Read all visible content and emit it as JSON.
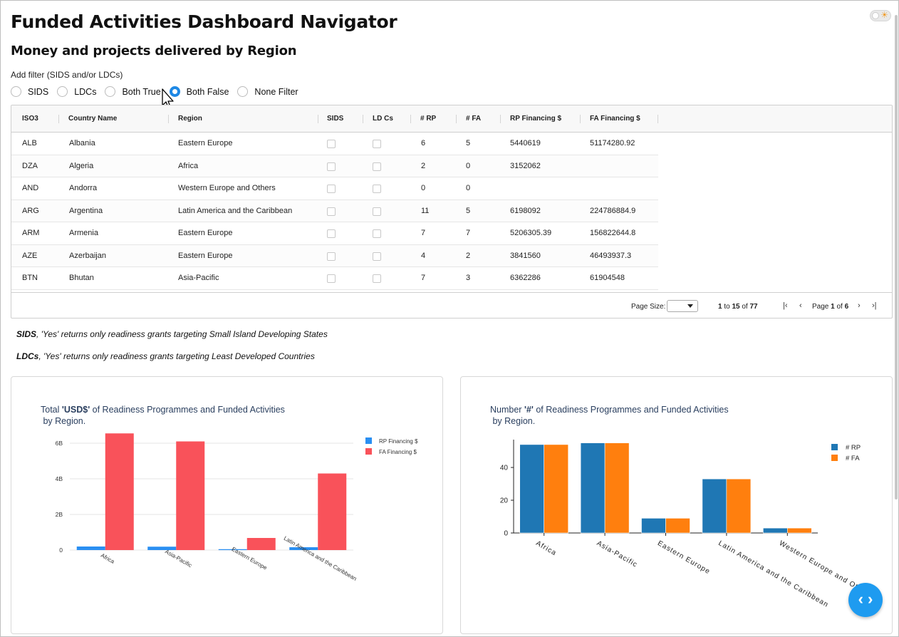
{
  "title": "Funded Activities Dashboard Navigator",
  "subtitle": "Money and projects delivered by Region",
  "filter": {
    "label": "Add filter (SIDS and/or LDCs)",
    "options": [
      "SIDS",
      "LDCs",
      "Both True",
      "Both False",
      "None Filter"
    ],
    "selected": "Both False"
  },
  "table": {
    "columns": [
      "ISO3",
      "Country Name",
      "Region",
      "SIDS",
      "LD Cs",
      "# RP",
      "# FA",
      "RP Financing $",
      "FA Financing $"
    ],
    "rows": [
      {
        "iso3": "ALB",
        "country": "Albania",
        "region": "Eastern Europe",
        "sids": false,
        "ldcs": false,
        "rp": "6",
        "fa": "5",
        "rp_fin": "5440619",
        "fa_fin": "51174280.92"
      },
      {
        "iso3": "DZA",
        "country": "Algeria",
        "region": "Africa",
        "sids": false,
        "ldcs": false,
        "rp": "2",
        "fa": "0",
        "rp_fin": "3152062",
        "fa_fin": ""
      },
      {
        "iso3": "AND",
        "country": "Andorra",
        "region": "Western Europe and Others",
        "sids": false,
        "ldcs": false,
        "rp": "0",
        "fa": "0",
        "rp_fin": "",
        "fa_fin": ""
      },
      {
        "iso3": "ARG",
        "country": "Argentina",
        "region": "Latin America and the Caribbean",
        "sids": false,
        "ldcs": false,
        "rp": "11",
        "fa": "5",
        "rp_fin": "6198092",
        "fa_fin": "224786884.9"
      },
      {
        "iso3": "ARM",
        "country": "Armenia",
        "region": "Eastern Europe",
        "sids": false,
        "ldcs": false,
        "rp": "7",
        "fa": "7",
        "rp_fin": "5206305.39",
        "fa_fin": "156822644.8"
      },
      {
        "iso3": "AZE",
        "country": "Azerbaijan",
        "region": "Eastern Europe",
        "sids": false,
        "ldcs": false,
        "rp": "4",
        "fa": "2",
        "rp_fin": "3841560",
        "fa_fin": "46493937.3"
      },
      {
        "iso3": "BTN",
        "country": "Bhutan",
        "region": "Asia-Pacific",
        "sids": false,
        "ldcs": false,
        "rp": "7",
        "fa": "3",
        "rp_fin": "6362286",
        "fa_fin": "61904548"
      }
    ],
    "pagination": {
      "page_size_label": "Page Size:",
      "range_from": "1",
      "range_to_word": "to",
      "range_to": "15",
      "range_of_word": "of",
      "range_total": "77",
      "page_word": "Page",
      "page_current": "1",
      "page_of_word": "of",
      "page_total": "6"
    }
  },
  "notes": {
    "sids_term": "SIDS",
    "sids_text": ", 'Yes' returns only readiness grants targeting Small Island Developing States",
    "ldcs_term": "LDCs",
    "ldcs_text": ", 'Yes' returns only readiness grants targeting Least Developed Countries"
  },
  "colors": {
    "accent": "#1e88e5",
    "rp_usd": "#2a8ff2",
    "fa_usd": "#f9525a",
    "rp_count": "#1f77b4",
    "fa_count": "#ff7f0e",
    "fab": "#1e9bf0"
  },
  "icons": {
    "toggle": "sun-icon",
    "fab": "code-icon",
    "pager": [
      "first-page-icon",
      "prev-page-icon",
      "next-page-icon",
      "last-page-icon"
    ]
  },
  "chart_data": [
    {
      "type": "bar",
      "title_prefix": "Total ",
      "title_bold": "'USD$'",
      "title_suffix": " of Readiness Programmes and Funded Activities",
      "title_line2": " by Region.",
      "categories": [
        "Africa",
        "Asia-Pacific",
        "Eastern Europe",
        "Latin America and the Caribbean"
      ],
      "series": [
        {
          "name": "RP Financing $",
          "values": [
            0.2,
            0.19,
            0.05,
            0.16
          ]
        },
        {
          "name": "FA Financing $",
          "values": [
            6.55,
            6.1,
            0.68,
            4.3
          ]
        }
      ],
      "yunit": "B",
      "yticks": [
        "0",
        "2B",
        "4B",
        "6B"
      ],
      "ylim": [
        0,
        6.5
      ],
      "grid": true,
      "legend": "top-right"
    },
    {
      "type": "bar",
      "title_prefix": "Number ",
      "title_bold": "'#'",
      "title_suffix": " of Readiness Programmes and Funded Activities",
      "title_line2": " by Region.",
      "categories": [
        "Africa",
        "Asia-Pacific",
        "Eastern Europe",
        "Latin America and the Caribbean",
        "Western Europe and Others"
      ],
      "series": [
        {
          "name": "# RP",
          "values": [
            54,
            55,
            9,
            33,
            3
          ]
        },
        {
          "name": "# FA",
          "values": [
            54,
            55,
            9,
            33,
            3
          ]
        }
      ],
      "yticks": [
        "0",
        "20",
        "40"
      ],
      "ylim": [
        0,
        57
      ],
      "grid": false,
      "legend": "top-right"
    }
  ]
}
